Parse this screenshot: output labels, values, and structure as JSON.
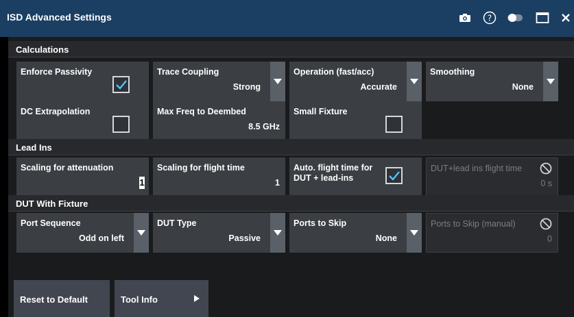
{
  "window": {
    "title": "ISD Advanced Settings"
  },
  "sections": {
    "calculations": "Calculations",
    "lead_ins": "Lead Ins",
    "dut_with_fixture": "DUT With Fixture"
  },
  "calculations": {
    "enforce_passivity": {
      "label": "Enforce Passivity",
      "checked": true
    },
    "trace_coupling": {
      "label": "Trace Coupling",
      "value": "Strong"
    },
    "operation": {
      "label": "Operation (fast/acc)",
      "value": "Accurate"
    },
    "smoothing": {
      "label": "Smoothing",
      "value": "None"
    },
    "dc_extrapolation": {
      "label": "DC Extrapolation",
      "checked": false
    },
    "max_freq": {
      "label": "Max Freq to Deembed",
      "value": "8.5 GHz"
    },
    "small_fixture": {
      "label": "Small Fixture",
      "checked": false
    }
  },
  "lead_ins": {
    "scaling_attenuation": {
      "label": "Scaling for attenuation",
      "value": "1"
    },
    "scaling_flight": {
      "label": "Scaling for flight time",
      "value": "1"
    },
    "auto_flight_line1": "Auto. flight time for",
    "auto_flight_line2": "DUT + lead-ins",
    "auto_flight_checked": true,
    "flight_time": {
      "label": "DUT+lead ins flight time",
      "value": "0 s"
    }
  },
  "dut_with_fixture": {
    "port_sequence": {
      "label": "Port Sequence",
      "value": "Odd on left"
    },
    "dut_type": {
      "label": "DUT Type",
      "value": "Passive"
    },
    "ports_to_skip": {
      "label": "Ports to Skip",
      "value": "None"
    },
    "ports_to_skip_manual": {
      "label": "Ports to Skip (manual)",
      "value": "0"
    }
  },
  "buttons": {
    "reset": "Reset to Default",
    "tool_info": "Tool Info"
  },
  "icons": {
    "camera": "camera-icon",
    "help": "help-icon",
    "toggle": "toggle-icon",
    "maximize": "maximize-icon",
    "close": "close-icon",
    "dropdown": "chevron-down-icon",
    "checkmark": "checkmark-icon",
    "disabled": "disabled-icon",
    "arrow": "arrow-right-icon"
  },
  "colors": {
    "titlebar": "#1b3f63",
    "cell": "#3b3e43",
    "dropdown": "#5a6068",
    "accent": "#1e88e5",
    "check": "#4fc3f7",
    "button": "#424650"
  }
}
